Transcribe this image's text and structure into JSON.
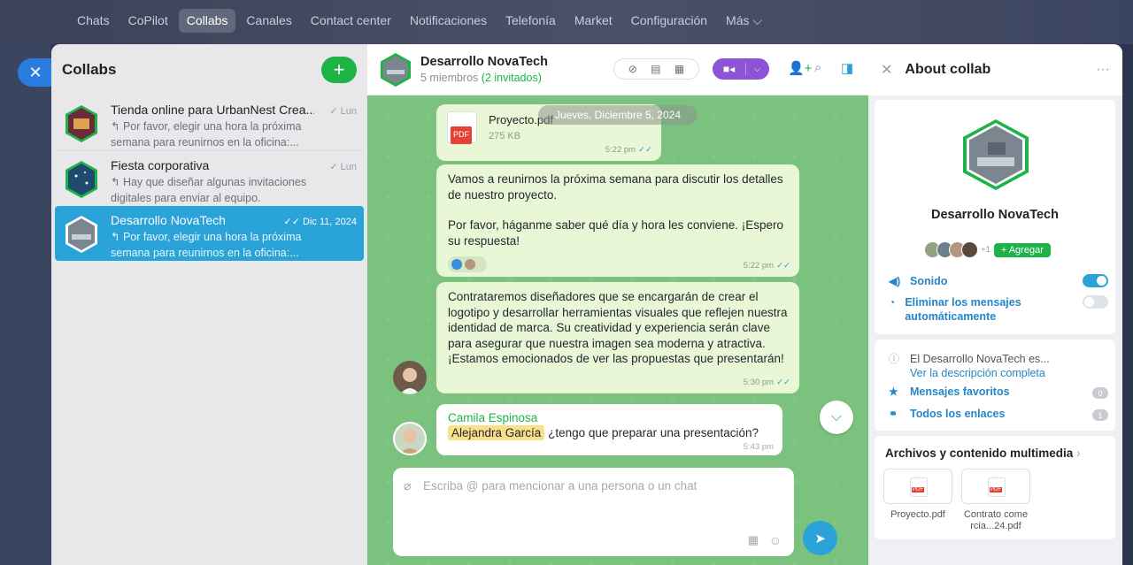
{
  "nav": {
    "items": [
      "Chats",
      "CoPilot",
      "Collabs",
      "Canales",
      "Contact center",
      "Notificaciones",
      "Telefonía",
      "Market",
      "Configuración",
      "Más ⌵"
    ],
    "active_index": 2
  },
  "sidebar": {
    "title": "Collabs",
    "add_label": "+",
    "conversations": [
      {
        "name": "Tienda online para UrbanNest Crea...",
        "date": "Lun",
        "preview": "↰ Por favor, elegir una hora la próxima semana para reunirnos en la oficina:...",
        "selected": false
      },
      {
        "name": "Fiesta corporativa",
        "date": "Lun",
        "preview": "↰ Hay que diseñar algunas invitaciones digitales para enviar al equipo.",
        "selected": false
      },
      {
        "name": "Desarrollo NovaTech",
        "date": "Dic 11, 2024",
        "preview": "↰ Por favor, elegir una hora la próxima semana para reunirnos en la oficina:...",
        "selected": true
      }
    ]
  },
  "chat": {
    "title": "Desarrollo NovaTech",
    "members": "5 miembros",
    "invited": "(2 invitados)",
    "date_divider": "Jueves, Diciembre 5, 2024",
    "file": {
      "name": "Proyecto.pdf",
      "size": "275 KB",
      "badge": "PDF",
      "time": "5:22 pm"
    },
    "msg1": {
      "p1": "Vamos a reunirnos la próxima semana para discutir los detalles de nuestro proyecto.",
      "p2": "Por favor, háganme saber qué día y hora les conviene. ¡Espero su respuesta!",
      "time": "5:22 pm"
    },
    "msg2": {
      "text": "Contrataremos diseñadores que se encargarán de crear el logotipo y desarrollar herramientas visuales que reflejen nuestra identidad de marca. Su creatividad y experiencia serán clave para asegurar que nuestra imagen sea moderna y atractiva. ¡Estamos emocionados de ver las propuestas que presentarán!",
      "time": "5:30 pm"
    },
    "msg3": {
      "author": "Camila Espinosa",
      "mention": "Alejandra García",
      "text": "¿tengo que preparar una presentación?",
      "time": "5:43 pm"
    },
    "composer_placeholder": "Escriba @ para mencionar a una persona o un chat"
  },
  "info": {
    "title": "About collab",
    "name": "Desarrollo NovaTech",
    "members_more": "+1",
    "add_label": "+ Agregar",
    "sound_label": "Sonido",
    "sound_on": true,
    "autodelete_label": "Eliminar los mensajes automáticamente",
    "autodelete_on": false,
    "description": "El Desarrollo NovaTech es...",
    "description_link": "Ver la descripción completa",
    "favorites_label": "Mensajes favoritos",
    "favorites_count": "0",
    "links_label": "Todos los enlaces",
    "links_count": "1",
    "files_title": "Archivos y contenido multimedia",
    "files": [
      {
        "name": "Proyecto.pdf",
        "badge": "PDF"
      },
      {
        "name": "Contrato come rcia...24.pdf",
        "badge": "PDF"
      }
    ]
  },
  "colors": {
    "accent": "#2aa3d9",
    "green": "#1eb347",
    "chat_bg": "#7cc27f",
    "bubble": "#e9f7d6",
    "video": "#8e52d6"
  }
}
